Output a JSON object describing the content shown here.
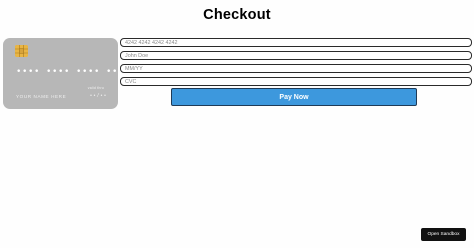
{
  "page": {
    "title": "Checkout"
  },
  "card_preview": {
    "number_masked": "•••• •••• •••• ••••",
    "valid_thru_label": "valid thru",
    "name_placeholder": "YOUR NAME HERE",
    "expiry_placeholder": "••/••",
    "chip_icon": "card-chip-icon"
  },
  "form": {
    "card_number": {
      "value": "",
      "placeholder": "4242 4242 4242 4242"
    },
    "name": {
      "value": "",
      "placeholder": "John Doe"
    },
    "expiry": {
      "value": "",
      "placeholder": "MM/YY"
    },
    "cvc": {
      "value": "",
      "placeholder": "CVC"
    },
    "pay_label": "Pay Now"
  },
  "footer": {
    "sandbox_label": "Open Sandbox"
  },
  "colors": {
    "pay_button": "#3d98dd",
    "card_background": "#b7b7b7",
    "chip": "#e9b544",
    "sandbox_button": "#111111"
  }
}
